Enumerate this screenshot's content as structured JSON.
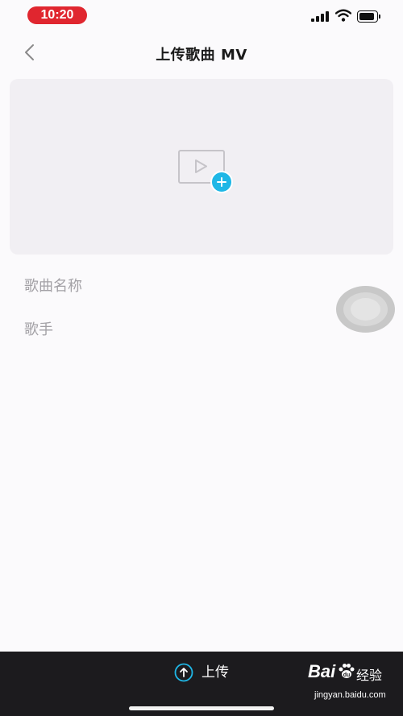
{
  "status_bar": {
    "time": "10:20"
  },
  "nav": {
    "title": "上传歌曲 MV"
  },
  "upload_area": {
    "icon": "video-add-icon"
  },
  "fields": {
    "song_name_placeholder": "歌曲名称",
    "singer_placeholder": "歌手"
  },
  "bottom_bar": {
    "upload_label": "上传"
  },
  "watermark": {
    "logo_text": "Bai",
    "brand_text": "经验",
    "url": "jingyan.baidu.com"
  },
  "colors": {
    "accent": "#1fb7e6",
    "time_pill": "#e0262f",
    "bottom_bar": "#1c1b1e",
    "placeholder": "#a3a1a6"
  }
}
